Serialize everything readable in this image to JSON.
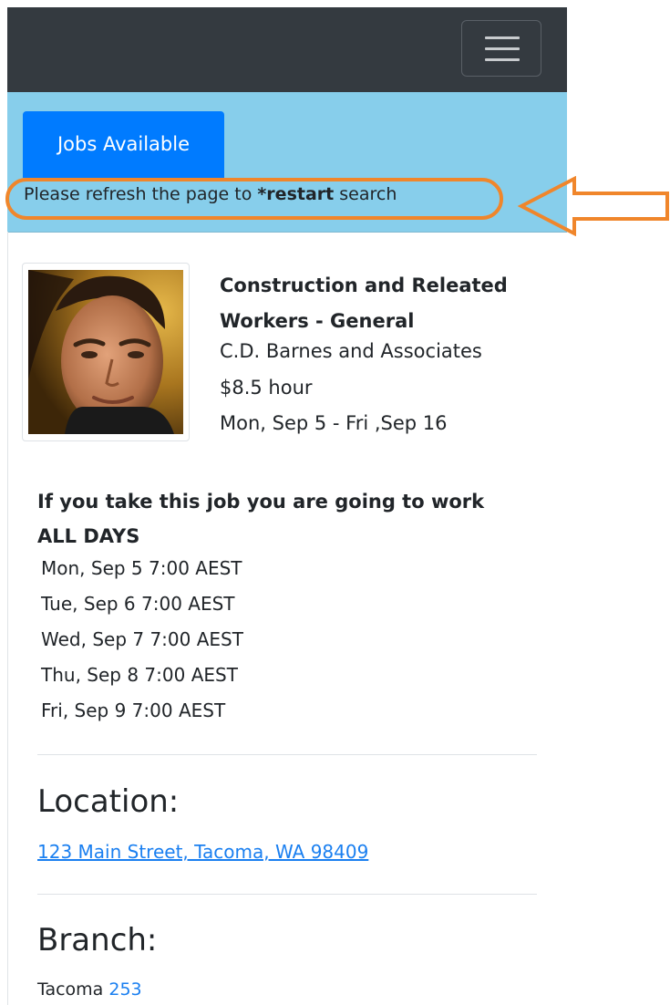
{
  "nav": {
    "menu_icon": "hamburger-icon"
  },
  "panel": {
    "tab_label": "Jobs Available",
    "refresh_prefix": "Please refresh the page to ",
    "refresh_bold": "*restart",
    "refresh_suffix": " search",
    "annotation_color": "#f0862b"
  },
  "job": {
    "title": "Construction and Releated Workers - General",
    "company": "C.D. Barnes and Associates",
    "pay": "$8.5 hour",
    "dates": "Mon, Sep 5 - Fri ,Sep 16"
  },
  "schedule": {
    "heading": "If you take this job you are going to work ALL DAYS",
    "days": [
      "Mon, Sep 5 7:00 AEST",
      "Tue, Sep 6 7:00 AEST",
      "Wed, Sep 7 7:00 AEST",
      "Thu, Sep 8 7:00 AEST",
      "Fri, Sep 9 7:00 AEST"
    ]
  },
  "location": {
    "heading": "Location:",
    "address": "123 Main Street, Tacoma, WA 98409"
  },
  "branch": {
    "heading": "Branch:",
    "name": "Tacoma",
    "phone": "253"
  },
  "colors": {
    "navbar": "#343a40",
    "panel": "#87ceeb",
    "primary": "#007bff",
    "link": "#1a7ff0"
  }
}
